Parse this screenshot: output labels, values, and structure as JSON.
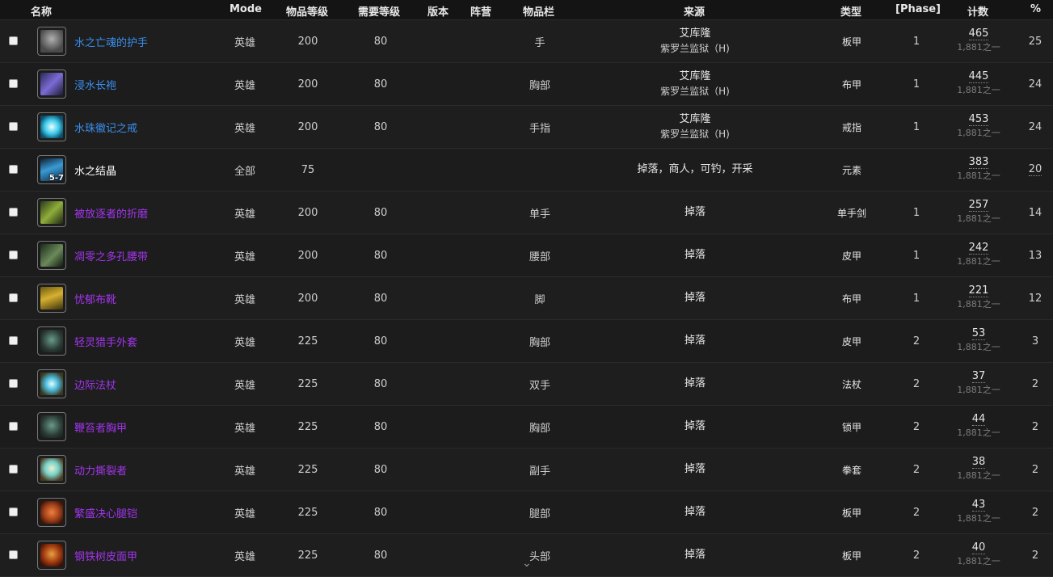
{
  "header": {
    "name": "名称",
    "mode": "Mode",
    "item_level": "物品等级",
    "req_level": "需要等级",
    "version": "版本",
    "faction": "阵营",
    "slot": "物品栏",
    "source": "来源",
    "type": "类型",
    "phase": "[Phase]",
    "count": "计数",
    "percent": "%"
  },
  "rows": [
    {
      "name": "水之亡魂的护手",
      "mode": "英雄",
      "ilvl": "200",
      "req": "80",
      "slot": "手",
      "src1": "艾库隆",
      "src2": "紫罗兰监狱（H)",
      "type": "板甲",
      "phase": "1",
      "count": "465",
      "total": "1,881之一",
      "pct": "25",
      "icon": "gauntlet-icon"
    },
    {
      "name": "浸水长袍",
      "mode": "英雄",
      "ilvl": "200",
      "req": "80",
      "slot": "胸部",
      "src1": "艾库隆",
      "src2": "紫罗兰监狱（H)",
      "type": "布甲",
      "phase": "1",
      "count": "445",
      "total": "1,881之一",
      "pct": "24",
      "icon": "robe-icon"
    },
    {
      "name": "水珠徽记之戒",
      "mode": "英雄",
      "ilvl": "200",
      "req": "80",
      "slot": "手指",
      "src1": "艾库隆",
      "src2": "紫罗兰监狱（H)",
      "type": "戒指",
      "phase": "1",
      "count": "453",
      "total": "1,881之一",
      "pct": "24",
      "icon": "ring-icon"
    },
    {
      "name": "水之结晶",
      "mode": "全部",
      "ilvl": "75",
      "req": "",
      "slot": "",
      "src1": "掉落，商人，可钓，开采",
      "src2": "",
      "type": "元素",
      "phase": "",
      "count": "383",
      "total": "1,881之一",
      "pct": "20",
      "icon": "crystal-icon",
      "badge": "5-7"
    },
    {
      "name": "被放逐者的折磨",
      "mode": "英雄",
      "ilvl": "200",
      "req": "80",
      "slot": "单手",
      "src1": "掉落",
      "src2": "",
      "type": "单手剑",
      "phase": "1",
      "count": "257",
      "total": "1,881之一",
      "pct": "14",
      "icon": "sword-icon"
    },
    {
      "name": "凋零之多孔腰带",
      "mode": "英雄",
      "ilvl": "200",
      "req": "80",
      "slot": "腰部",
      "src1": "掉落",
      "src2": "",
      "type": "皮甲",
      "phase": "1",
      "count": "242",
      "total": "1,881之一",
      "pct": "13",
      "icon": "belt-icon"
    },
    {
      "name": "忧郁布靴",
      "mode": "英雄",
      "ilvl": "200",
      "req": "80",
      "slot": "脚",
      "src1": "掉落",
      "src2": "",
      "type": "布甲",
      "phase": "1",
      "count": "221",
      "total": "1,881之一",
      "pct": "12",
      "icon": "boots-icon"
    },
    {
      "name": "轻灵猎手外套",
      "mode": "英雄",
      "ilvl": "225",
      "req": "80",
      "slot": "胸部",
      "src1": "掉落",
      "src2": "",
      "type": "皮甲",
      "phase": "2",
      "count": "53",
      "total": "1,881之一",
      "pct": "3",
      "icon": "chest-armor-icon"
    },
    {
      "name": "边际法杖",
      "mode": "英雄",
      "ilvl": "225",
      "req": "80",
      "slot": "双手",
      "src1": "掉落",
      "src2": "",
      "type": "法杖",
      "phase": "2",
      "count": "37",
      "total": "1,881之一",
      "pct": "2",
      "icon": "staff-icon"
    },
    {
      "name": "鞭笞者胸甲",
      "mode": "英雄",
      "ilvl": "225",
      "req": "80",
      "slot": "胸部",
      "src1": "掉落",
      "src2": "",
      "type": "锁甲",
      "phase": "2",
      "count": "44",
      "total": "1,881之一",
      "pct": "2",
      "icon": "chest-armor-icon"
    },
    {
      "name": "动力撕裂者",
      "mode": "英雄",
      "ilvl": "225",
      "req": "80",
      "slot": "副手",
      "src1": "掉落",
      "src2": "",
      "type": "拳套",
      "phase": "2",
      "count": "38",
      "total": "1,881之一",
      "pct": "2",
      "icon": "fist-weapon-icon"
    },
    {
      "name": "繁盛决心腿铠",
      "mode": "英雄",
      "ilvl": "225",
      "req": "80",
      "slot": "腿部",
      "src1": "掉落",
      "src2": "",
      "type": "板甲",
      "phase": "2",
      "count": "43",
      "total": "1,881之一",
      "pct": "2",
      "icon": "legplate-icon"
    },
    {
      "name": "钢铁树皮面甲",
      "mode": "英雄",
      "ilvl": "225",
      "req": "80",
      "slot": "头部",
      "src1": "掉落",
      "src2": "",
      "type": "板甲",
      "phase": "2",
      "count": "40",
      "total": "1,881之一",
      "pct": "2",
      "icon": "helm-icon"
    }
  ],
  "scroll_hint_icon": "chevron-down-icon"
}
